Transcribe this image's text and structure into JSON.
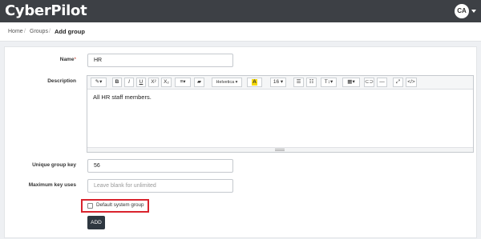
{
  "header": {
    "brand": "CyberPilot",
    "avatar_initials": "CA"
  },
  "breadcrumb": {
    "home": "Home",
    "sep1": "/",
    "groups": "Groups",
    "sep2": "/",
    "current": "Add group"
  },
  "form": {
    "name_label": "Name",
    "name_required_mark": "*",
    "name_value": "HR",
    "description_label": "Description",
    "description_value": "All HR staff members.",
    "unique_key_label": "Unique group key",
    "unique_key_value": "56",
    "max_uses_label": "Maximum key uses",
    "max_uses_placeholder": "Leave blank for unlimited",
    "default_group_label": "Default system group",
    "default_group_checked": false,
    "add_button": "ADD"
  },
  "toolbar": {
    "magic_glyph": "✎▾",
    "bold": "B",
    "italic": "I",
    "underline": "U",
    "superscript": "X²",
    "subscript": "X₂",
    "align": "≡▾",
    "eraser": "▰",
    "font": "Helvetica ▾",
    "color": "A",
    "size": "16 ▾",
    "ul": "☰",
    "ol": "☷",
    "heading": "T↕▾",
    "table": "▦▾",
    "link": "⊂⊃",
    "hr": "—",
    "fullscreen": "⤢",
    "code": "</>"
  },
  "colors": {
    "topbar": "#3d4045",
    "primary_button": "#2e3740",
    "highlight": "#f5d90a",
    "annotation_red": "#d9232d"
  }
}
